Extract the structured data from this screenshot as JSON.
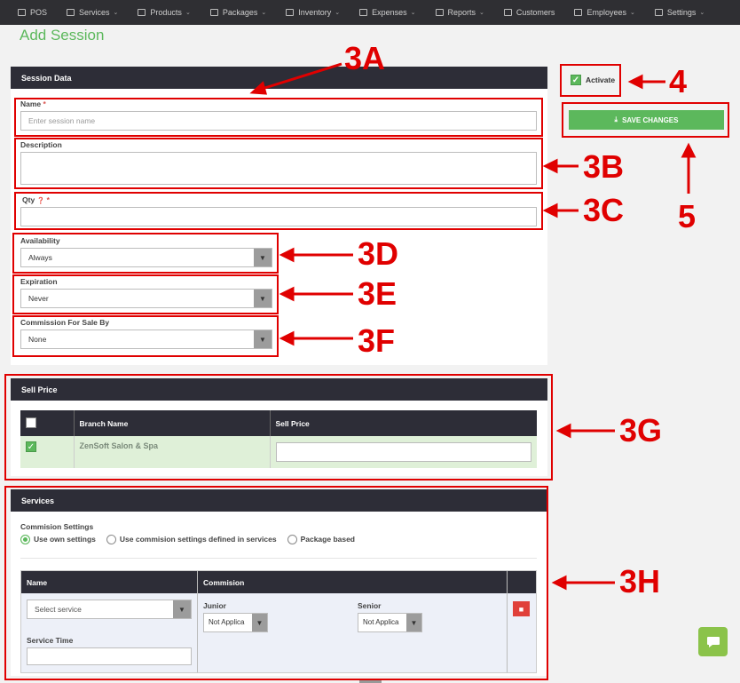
{
  "nav": {
    "items": [
      {
        "label": "POS",
        "icon": "pos-icon",
        "dropdown": false
      },
      {
        "label": "Services",
        "icon": "services-icon",
        "dropdown": true
      },
      {
        "label": "Products",
        "icon": "products-icon",
        "dropdown": true
      },
      {
        "label": "Packages",
        "icon": "packages-icon",
        "dropdown": true
      },
      {
        "label": "Inventory",
        "icon": "inventory-icon",
        "dropdown": true
      },
      {
        "label": "Expenses",
        "icon": "expenses-icon",
        "dropdown": true
      },
      {
        "label": "Reports",
        "icon": "reports-icon",
        "dropdown": true
      },
      {
        "label": "Customers",
        "icon": "customers-icon",
        "dropdown": false
      },
      {
        "label": "Employees",
        "icon": "employees-icon",
        "dropdown": true
      },
      {
        "label": "Settings",
        "icon": "settings-icon",
        "dropdown": true
      }
    ]
  },
  "page": {
    "title": "Add Session"
  },
  "session": {
    "header": "Session Data",
    "name_label": "Name",
    "required_mark": "*",
    "name_placeholder": "Enter session name",
    "description_label": "Description",
    "qty_label": "Qty",
    "qty_help": "❓",
    "availability_label": "Availability",
    "availability_value": "Always",
    "expiration_label": "Expiration",
    "expiration_value": "Never",
    "commission_label": "Commission For Sale By",
    "commission_value": "None"
  },
  "sidebar": {
    "activate_label": "Activate",
    "save_label": "SAVE CHANGES"
  },
  "sell_price": {
    "header": "Sell Price",
    "columns": [
      "Branch Name",
      "Sell Price"
    ],
    "rows": [
      {
        "branch": "ZenSoft Salon & Spa",
        "price": ""
      }
    ]
  },
  "services": {
    "header": "Services",
    "commission_settings_label": "Commision Settings",
    "options": [
      "Use own settings",
      "Use commision settings defined in services",
      "Package based"
    ],
    "table_columns": [
      "Name",
      "Commision"
    ],
    "select_service_placeholder": "Select service",
    "service_time_label": "Service Time",
    "junior_label": "Junior",
    "junior_value": "Not Applica",
    "senior_label": "Senior",
    "senior_value": "Not Applica"
  },
  "annotations": {
    "a3A": "3A",
    "a3B": "3B",
    "a3C": "3C",
    "a3D": "3D",
    "a3E": "3E",
    "a3F": "3F",
    "a3G": "3G",
    "a3H": "3H",
    "a4": "4",
    "a5": "5"
  },
  "colors": {
    "accent": "#5cb85c",
    "header": "#2d2d37",
    "annotation": "#e00000"
  }
}
